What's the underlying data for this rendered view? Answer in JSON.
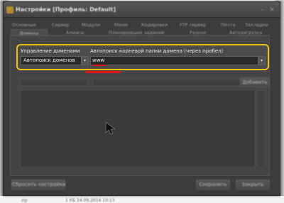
{
  "window": {
    "title": "Настройки [Профиль: Default]",
    "minimize_glyph": "–",
    "close_glyph": "×"
  },
  "tabs_row1": [
    "Основные",
    "Сервер",
    "Модули",
    "Меню",
    "Кодировки",
    "FTP сервер",
    "Почта",
    "Закладки"
  ],
  "tabs_row2": [
    "Домены",
    "Алиасы",
    "Планировщик заданий",
    "Разное",
    "Автозагрузка"
  ],
  "active_tab": "Домены",
  "domains": {
    "management_label": "Управление доменами",
    "autosearch_label": "Автопоиск корневой папки домена (через пробел)",
    "management_value": "Автопоиск доменов",
    "autosearch_value": "www",
    "dropdown_glyph": "▾"
  },
  "add_button": "Добавить",
  "footer": {
    "reset_button": "Сбросить настройки",
    "save_button": "Сохранить",
    "close_button": "Закрыть"
  },
  "background_text": {
    "filename": "zip",
    "details": "1 КБ  24.09.2014 10:13"
  },
  "colors": {
    "highlight": "#f2c100",
    "annotation_red": "#e01010",
    "window_bg": "#3c3c3c"
  },
  "icons": [
    "app-icon",
    "minimize-icon",
    "close-icon",
    "dropdown-arrow-icon",
    "mouse-cursor-icon"
  ]
}
